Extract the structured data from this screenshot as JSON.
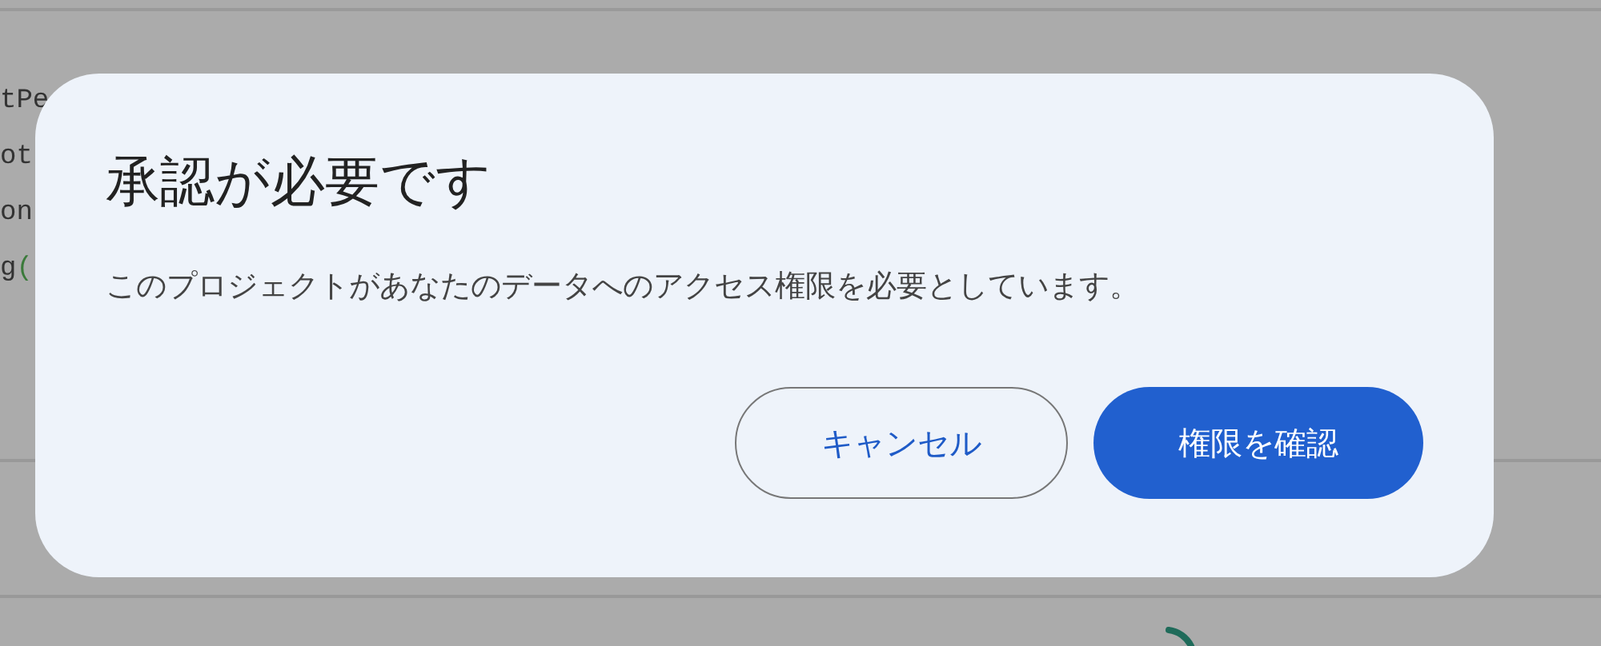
{
  "background_code": [
    "tPe",
    "ot",
    "on",
    "g("
  ],
  "dialog": {
    "title": "承認が必要です",
    "message": "このプロジェクトがあなたのデータへのアクセス権限を必要としています。",
    "buttons": [
      {
        "label": "キャンセル",
        "kind": "outline"
      },
      {
        "label": "権限を確認",
        "kind": "filled"
      }
    ]
  }
}
